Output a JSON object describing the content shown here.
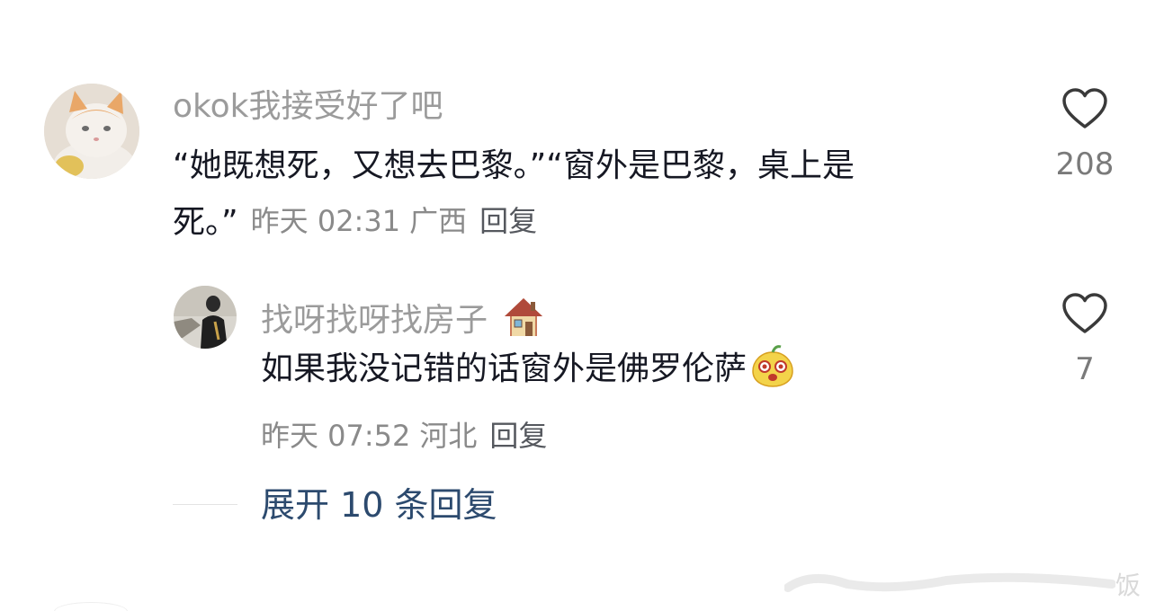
{
  "comment1": {
    "username": "okok我接受好了吧",
    "text": "“她既想死，又想去巴黎。”“窗外是巴黎，桌上是死。”",
    "time": "昨天 02:31",
    "location": "广西",
    "reply_label": "回复",
    "like_count": "208",
    "avatar_icon": "cat-avatar-icon"
  },
  "comment2": {
    "username": "找呀找呀找房子",
    "username_emoji": "house-emoji-icon",
    "text": "如果我没记错的话窗外是佛罗伦萨",
    "text_emoji": "cute-face-emoji-icon",
    "time": "昨天 07:52",
    "location": "河北",
    "reply_label": "回复",
    "like_count": "7"
  },
  "expand": {
    "label": "展开 10 条回复"
  },
  "watermark": {
    "text": "饭"
  },
  "colors": {
    "username": "#9b9b9b",
    "text": "#161823",
    "meta": "#8a8a8a",
    "expand": "#2c4a6e"
  }
}
